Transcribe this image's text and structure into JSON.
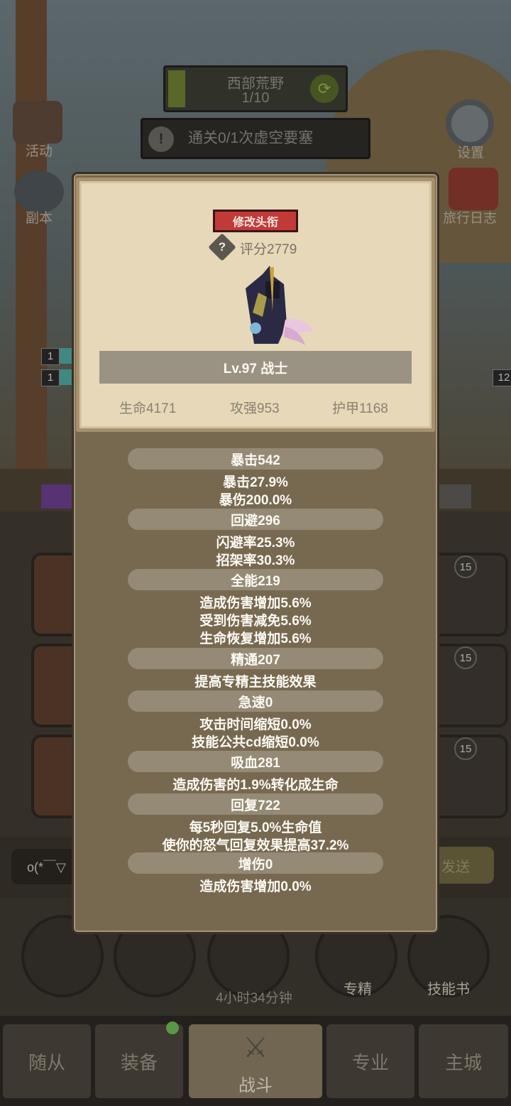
{
  "hud": {
    "zone_name": "西部荒野",
    "zone_progress": "1/10",
    "quest_text": "通关0/1次虚空要塞"
  },
  "side_menu": {
    "activity": "活动",
    "dungeon": "副本",
    "settings": "设置",
    "travel_log": "旅行日志"
  },
  "level_chips": [
    "1",
    "1",
    "12"
  ],
  "inventory_counts": [
    "15",
    "15",
    "15"
  ],
  "chat": {
    "input_value": "o(*￣▽",
    "send_label": "发送"
  },
  "round_buttons": {
    "specialization": "专精",
    "skill_book": "技能书",
    "timer": "4小时34分钟"
  },
  "bottom_nav": {
    "followers": "随从",
    "equipment": "装备",
    "battle": "战斗",
    "profession": "专业",
    "main_city": "主城"
  },
  "character": {
    "change_title_label": "修改头衔",
    "score": "评分2779",
    "name_line": "Lv.97 战士",
    "health": "生命4171",
    "attack_power": "攻强953",
    "armor": "护甲1168"
  },
  "stat_sections": [
    {
      "header": "暴击542",
      "lines": [
        "暴击27.9%",
        "暴伤200.0%"
      ]
    },
    {
      "header": "回避296",
      "lines": [
        "闪避率25.3%",
        "招架率30.3%"
      ]
    },
    {
      "header": "全能219",
      "lines": [
        "造成伤害增加5.6%",
        "受到伤害减免5.6%",
        "生命恢复增加5.6%"
      ]
    },
    {
      "header": "精通207",
      "lines": [
        "提高专精主技能效果"
      ]
    },
    {
      "header": "急速0",
      "lines": [
        "攻击时间缩短0.0%",
        "技能公共cd缩短0.0%"
      ]
    },
    {
      "header": "吸血281",
      "lines": [
        "造成伤害的1.9%转化成生命"
      ]
    },
    {
      "header": "回复722",
      "lines": [
        "每5秒回复5.0%生命值",
        "使你的怒气回复效果提高37.2%"
      ]
    },
    {
      "header": "增伤0",
      "lines": [
        "造成伤害增加0.0%"
      ]
    }
  ]
}
